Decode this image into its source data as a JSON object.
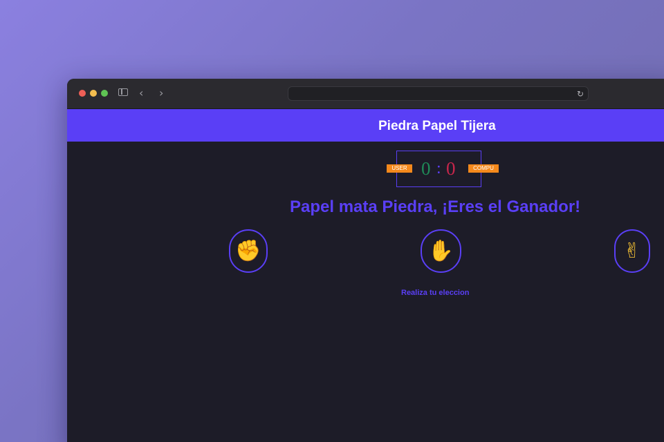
{
  "browser": {
    "address_value": "",
    "icons": [
      "sidebar-icon",
      "back-icon",
      "forward-icon",
      "reload-icon"
    ]
  },
  "app": {
    "title": "Piedra Papel Tijera"
  },
  "scoreboard": {
    "user_label": "USER",
    "comp_label": "COMPU",
    "user_score": "0",
    "separator": ":",
    "comp_score": "0"
  },
  "result": {
    "message": "Papel mata Piedra, ¡Eres el Ganador!"
  },
  "choices": [
    {
      "name": "piedra",
      "icon": "fist-icon",
      "glyph": "✊"
    },
    {
      "name": "papel",
      "icon": "hand-icon",
      "glyph": "✋"
    },
    {
      "name": "tijera",
      "icon": "victory-icon",
      "glyph": "✌"
    }
  ],
  "hint": {
    "text": "Realiza tu eleccion"
  },
  "colors": {
    "accent": "#5a3ff6",
    "badge": "#f5891c",
    "user_score": "#1f8a57",
    "comp_score": "#c8264b",
    "background": "#1d1c28"
  }
}
